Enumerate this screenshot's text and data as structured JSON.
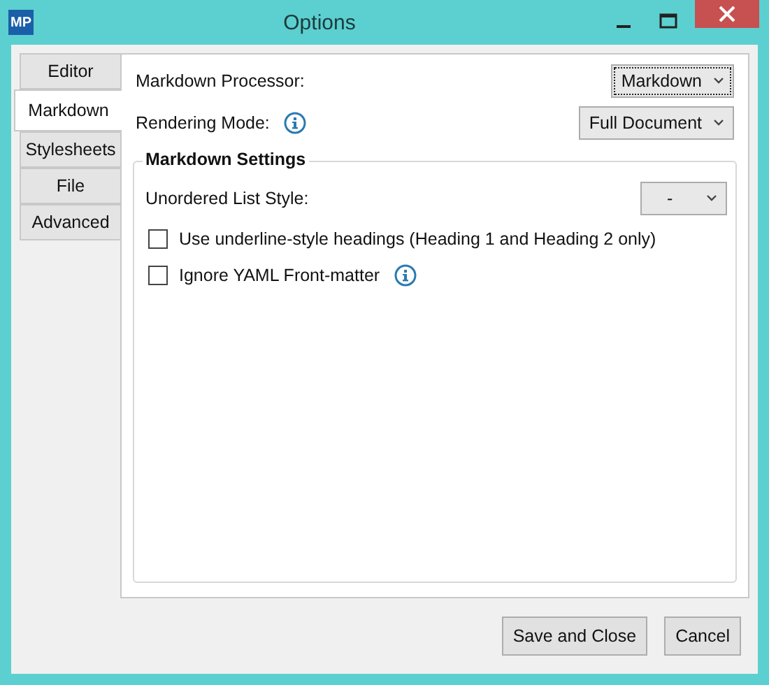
{
  "window": {
    "logo": "MP",
    "title": "Options"
  },
  "tabs": [
    {
      "label": "Editor",
      "selected": false
    },
    {
      "label": "Markdown",
      "selected": true
    },
    {
      "label": "Stylesheets",
      "selected": false
    },
    {
      "label": "File",
      "selected": false
    },
    {
      "label": "Advanced",
      "selected": false
    }
  ],
  "settings": [
    {
      "label": "Markdown Processor:",
      "info": false,
      "value": "Markdown",
      "focused": true
    },
    {
      "label": "Rendering Mode:",
      "info": true,
      "value": "Full Document",
      "focused": false
    }
  ],
  "group": {
    "title": "Markdown Settings",
    "items": [
      {
        "kind": "dropdown",
        "label": "Unordered List Style:",
        "option": "-",
        "info": false
      },
      {
        "kind": "checkbox",
        "label": "Use underline-style headings (Heading 1 and Heading 2 only)",
        "checked": false,
        "info": false
      },
      {
        "kind": "checkbox",
        "label": "Ignore YAML Front-matter",
        "checked": false,
        "info": true
      }
    ]
  },
  "buttons": [
    "Save and Close",
    "Cancel"
  ]
}
